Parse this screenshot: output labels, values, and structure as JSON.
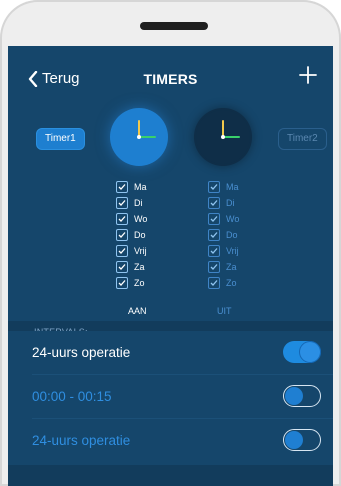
{
  "nav": {
    "back_label": "Terug",
    "title": "TIMERS",
    "add_label": "+"
  },
  "timers": {
    "timer1_label": "Timer1",
    "timer2_label": "Timer2"
  },
  "days_on": [
    {
      "label": "Ma",
      "checked": true
    },
    {
      "label": "Di",
      "checked": true
    },
    {
      "label": "Wo",
      "checked": true
    },
    {
      "label": "Do",
      "checked": true
    },
    {
      "label": "Vrij",
      "checked": true
    },
    {
      "label": "Za",
      "checked": true
    },
    {
      "label": "Zo",
      "checked": true
    }
  ],
  "days_off": [
    {
      "label": "Ma",
      "checked": true
    },
    {
      "label": "Di",
      "checked": true
    },
    {
      "label": "Wo",
      "checked": true
    },
    {
      "label": "Do",
      "checked": true
    },
    {
      "label": "Vrij",
      "checked": true
    },
    {
      "label": "Za",
      "checked": true
    },
    {
      "label": "Zo",
      "checked": true
    }
  ],
  "captions": {
    "on": "AAN",
    "off": "UIT"
  },
  "intervals": {
    "header": "INTERVALS:",
    "rows": [
      {
        "label": "24-uurs operatie",
        "enabled": true
      },
      {
        "label": "00:00 - 00:15",
        "enabled": false
      },
      {
        "label": "24-uurs operatie",
        "enabled": false
      }
    ]
  },
  "colors": {
    "background": "#15466b",
    "accent": "#1e8be0",
    "inactive_text": "#2f8ee0",
    "hand_hour": "#f2c94c",
    "hand_minute": "#39d16b"
  },
  "icons": {
    "back": "chevron-left-icon",
    "add": "plus-icon",
    "check": "checkmark-icon"
  }
}
